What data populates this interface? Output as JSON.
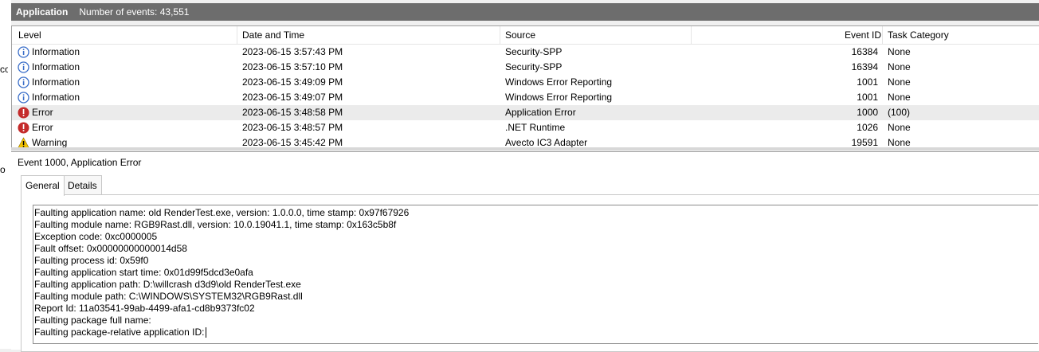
{
  "window": {
    "title": "Application",
    "event_count_text": "Number of events: 43,551"
  },
  "left_fragments": [
    "co",
    "o"
  ],
  "columns": {
    "level": "Level",
    "datetime": "Date and Time",
    "source": "Source",
    "event_id": "Event ID",
    "task_category": "Task Category"
  },
  "events": [
    {
      "level": "Information",
      "icon": "information-icon",
      "datetime": "2023-06-15 3:57:43 PM",
      "source": "Security-SPP",
      "event_id": "16384",
      "task": "None"
    },
    {
      "level": "Information",
      "icon": "information-icon",
      "datetime": "2023-06-15 3:57:10 PM",
      "source": "Security-SPP",
      "event_id": "16394",
      "task": "None"
    },
    {
      "level": "Information",
      "icon": "information-icon",
      "datetime": "2023-06-15 3:49:09 PM",
      "source": "Windows Error Reporting",
      "event_id": "1001",
      "task": "None"
    },
    {
      "level": "Information",
      "icon": "information-icon",
      "datetime": "2023-06-15 3:49:07 PM",
      "source": "Windows Error Reporting",
      "event_id": "1001",
      "task": "None"
    },
    {
      "level": "Error",
      "icon": "error-icon",
      "datetime": "2023-06-15 3:48:58 PM",
      "source": "Application Error",
      "event_id": "1000",
      "task": "(100)",
      "selected": true
    },
    {
      "level": "Error",
      "icon": "error-icon",
      "datetime": "2023-06-15 3:48:57 PM",
      "source": ".NET Runtime",
      "event_id": "1026",
      "task": "None"
    },
    {
      "level": "Warning",
      "icon": "warning-icon",
      "datetime": "2023-06-15 3:45:42 PM",
      "source": "Avecto IC3 Adapter",
      "event_id": "19591",
      "task": "None"
    }
  ],
  "detail": {
    "title": "Event 1000, Application Error",
    "tabs": [
      "General",
      "Details"
    ],
    "active_tab": "General",
    "lines": [
      "Faulting application name: old RenderTest.exe, version: 1.0.0.0, time stamp: 0x97f67926",
      "Faulting module name: RGB9Rast.dll, version: 10.0.19041.1, time stamp: 0x163c5b8f",
      "Exception code: 0xc0000005",
      "Fault offset: 0x00000000000014d58",
      "Faulting process id: 0x59f0",
      "Faulting application start time: 0x01d99f5dcd3e0afa",
      "Faulting application path: D:\\willcrash d3d9\\old RenderTest.exe",
      "Faulting module path: C:\\WINDOWS\\SYSTEM32\\RGB9Rast.dll",
      "Report Id: 11a03541-99ab-4499-afa1-cd8b9373fc02",
      "Faulting package full name:",
      "Faulting package-relative application ID:"
    ]
  },
  "colors": {
    "titlebar": "#6d6d6d",
    "selected_row": "#ebebeb",
    "info_icon": "#3a6ec9",
    "error_icon": "#c42b2b",
    "warning_icon": "#f2c200"
  }
}
